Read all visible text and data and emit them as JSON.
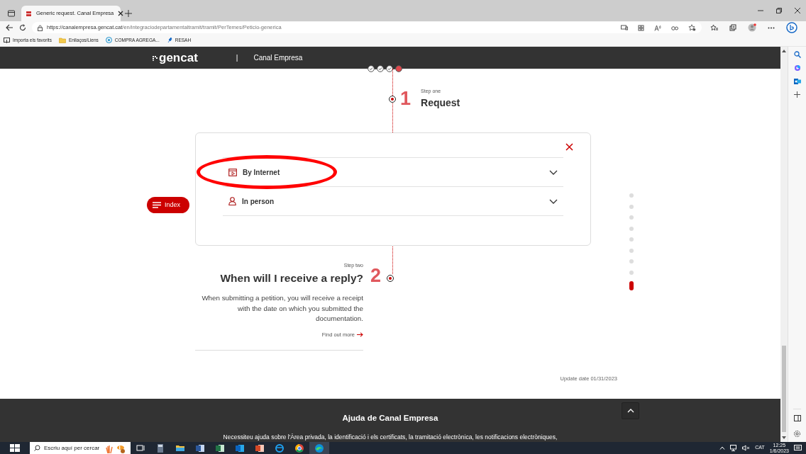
{
  "browser": {
    "tab_title": "Generic request. Canal Empresa",
    "url_host": "https://canalempresa.gencat.cat",
    "url_path": "/en/integraciodepartamentaltramit/tramit/PerTemes/Peticio-generica",
    "bookmarks": [
      {
        "label": "Importa els favorits",
        "kind": "import"
      },
      {
        "label": "Enllaços/Liens",
        "kind": "folder"
      },
      {
        "label": "COMPRA AGREGA...",
        "kind": "site"
      },
      {
        "label": "RESAH",
        "kind": "pin"
      }
    ]
  },
  "header": {
    "logo": "gencat",
    "separator": "|",
    "site": "Canal Empresa"
  },
  "progress_marks": [
    {
      "checked": true
    },
    {
      "checked": true
    },
    {
      "checked": true
    },
    {
      "checked": false
    }
  ],
  "steps": [
    {
      "number": "1",
      "caption": "Step one",
      "title": "Request"
    },
    {
      "number": "2",
      "caption": "Step two",
      "title": "When will I receive a reply?",
      "text": "When submitting a petition, you will receive a receipt with the date on which you submitted the documentation.",
      "link": "Find out more"
    }
  ],
  "index_button": "Index",
  "modal": {
    "options": [
      {
        "label": "By Internet",
        "kind": "internet",
        "expanded": false,
        "highlighted": true
      },
      {
        "label": "In person",
        "kind": "person",
        "expanded": false,
        "highlighted": false
      }
    ]
  },
  "section_dots": [
    {
      "selected": false
    },
    {
      "selected": false
    },
    {
      "selected": false
    },
    {
      "selected": false
    },
    {
      "selected": false
    },
    {
      "selected": false
    },
    {
      "selected": false
    },
    {
      "selected": false
    },
    {
      "selected": true
    }
  ],
  "update_date": "Update date 01/31/2023",
  "footer": {
    "title": "Ajuda de Canal Empresa",
    "text": "Necessiteu ajuda sobre l'Àrea privada, la identificació i els certificats, la tramitació electrònica, les notificacions electròniques,"
  },
  "taskbar": {
    "search_placeholder": "Escriu aquí per cercar",
    "language": "CAT",
    "time": "12:25",
    "date": "1/6/2023"
  }
}
